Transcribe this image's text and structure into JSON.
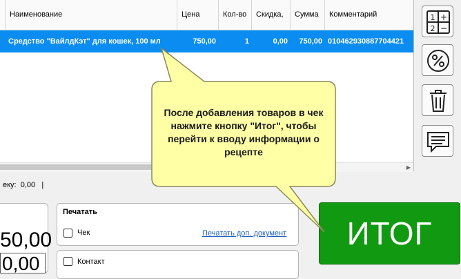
{
  "table": {
    "columns": [
      "Наименование",
      "Цена",
      "Кол-во",
      "Скидка,",
      "Сумма",
      "Комментарий"
    ],
    "rows": [
      {
        "name": "Средство \"ВайлдКэт\" для кошек, 100 мл",
        "price": "750,00",
        "qty": "1",
        "discount": "0,00",
        "sum": "750,00",
        "comment": "010462930887704421"
      }
    ]
  },
  "status": {
    "prefix": "еку:",
    "value": "0,00",
    "sep": "|"
  },
  "totals": {
    "big_total": "50,00",
    "input_value": "0,00"
  },
  "print_panel": {
    "title": "Печатать",
    "check_label": "Чек",
    "extra_doc_link": "Печатать доп. документ"
  },
  "contact_panel": {
    "label": "Контакт"
  },
  "itog_button": {
    "label": "ИТОГ"
  },
  "hint": {
    "text": "После добавления товаров в чек нажмите кнопку \"Итог\", чтобы перейти к вводу информации о рецепте"
  },
  "tools": [
    {
      "icon": "calculator-icon"
    },
    {
      "icon": "percent-icon"
    },
    {
      "icon": "trash-icon"
    },
    {
      "icon": "comment-icon"
    }
  ],
  "colors": {
    "selection": "#0a8cf0",
    "itog": "#119a11",
    "hint_bg": "#ffffa6",
    "link": "#1f5fbf"
  }
}
